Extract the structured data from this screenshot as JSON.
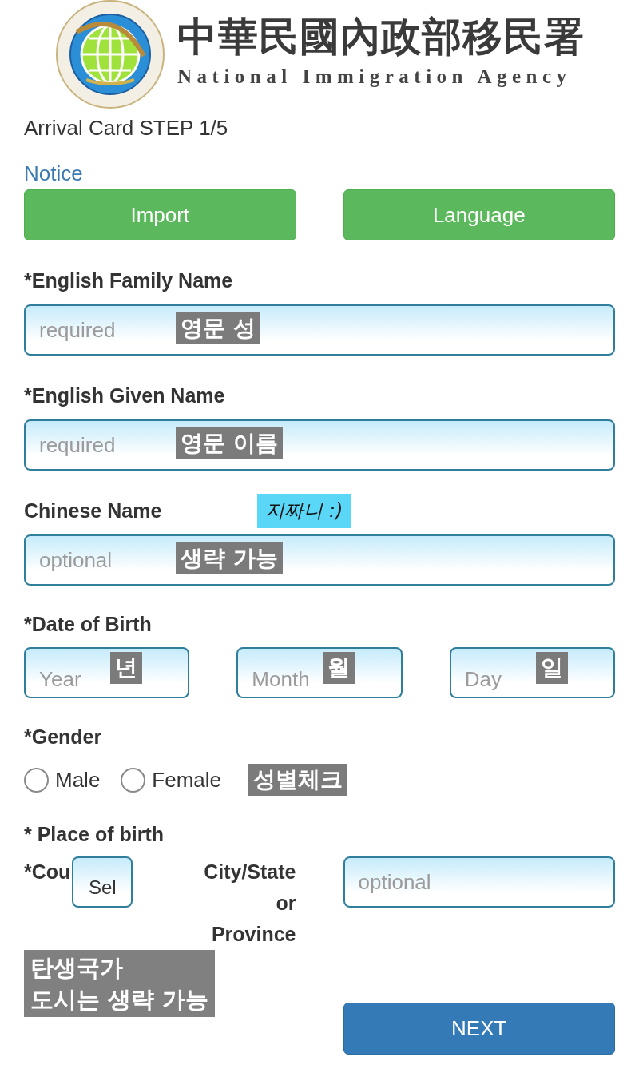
{
  "header": {
    "agency_name_zh": "中華民國內政部移民署",
    "agency_name_en": "National Immigration Agency"
  },
  "page_title": "Arrival Card STEP 1/5",
  "notice_link": "Notice",
  "action_buttons": [
    {
      "label": "Import"
    },
    {
      "label": "Language"
    }
  ],
  "name_fields": [
    {
      "label": "*English Family Name",
      "placeholder": "required",
      "note": "영문 성"
    },
    {
      "label": "*English Given Name",
      "placeholder": "required",
      "note": "영문 이름"
    },
    {
      "label": "Chinese Name",
      "side_note": "지짜니 :)",
      "placeholder": "optional",
      "note": "생략 가능"
    }
  ],
  "date_of_birth": {
    "label": "*Date of Birth",
    "parts": [
      {
        "placeholder": "Year",
        "note": "년"
      },
      {
        "placeholder": "Month",
        "note": "월"
      },
      {
        "placeholder": "Day",
        "note": "일"
      }
    ]
  },
  "gender": {
    "label": "*Gender",
    "options": [
      {
        "label": "Male",
        "selected": false
      },
      {
        "label": "Female",
        "selected": false
      }
    ],
    "note": "성별체크"
  },
  "place_of_birth": {
    "label": "* Place of birth",
    "country_label": "*Cou",
    "country_select": "Sel",
    "city_label": "City/State or Province",
    "city_placeholder": "optional",
    "note_lines": [
      "탄생국가",
      "도시는 생략 가능"
    ]
  },
  "next_button": "NEXT"
}
